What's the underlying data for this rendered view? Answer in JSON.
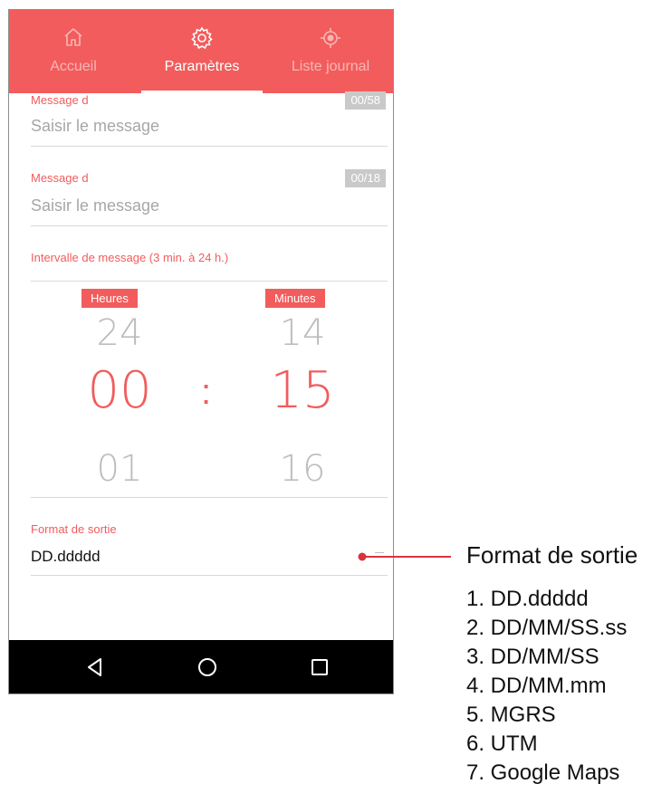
{
  "tabs": [
    {
      "label": "Accueil",
      "icon": "home-icon"
    },
    {
      "label": "Paramètres",
      "icon": "gear-icon"
    },
    {
      "label": "Liste journal",
      "icon": "location-icon"
    }
  ],
  "active_tab": 1,
  "fields": {
    "message1": {
      "label": "Message d",
      "counter": "00/58",
      "placeholder": "Saisir le message"
    },
    "message2": {
      "label": "Message d",
      "counter": "00/18",
      "placeholder": "Saisir le message"
    },
    "interval": {
      "label": "Intervalle de message (3 min. à 24 h.)"
    }
  },
  "picker": {
    "hours_label": "Heures",
    "minutes_label": "Minutes",
    "hours": {
      "prev": "24",
      "current": "00",
      "next": "01"
    },
    "minutes": {
      "prev": "14",
      "current": "15",
      "next": "16"
    },
    "separator": ":"
  },
  "output_format": {
    "label": "Format de sortie",
    "value": "DD.ddddd"
  },
  "annotation": {
    "title": "Format de sortie",
    "items": [
      "1. DD.ddddd",
      "2. DD/MM/SS.ss",
      "3. DD/MM/SS",
      "4. DD/MM.mm",
      "5. MGRS",
      "6. UTM",
      "7. Google Maps"
    ]
  },
  "navbar": {
    "icons": [
      "back-icon",
      "home-circle-icon",
      "recents-icon"
    ]
  },
  "colors": {
    "accent": "#f25c5c",
    "navbar": "#000000",
    "counter_bg": "#c9c9c9"
  }
}
